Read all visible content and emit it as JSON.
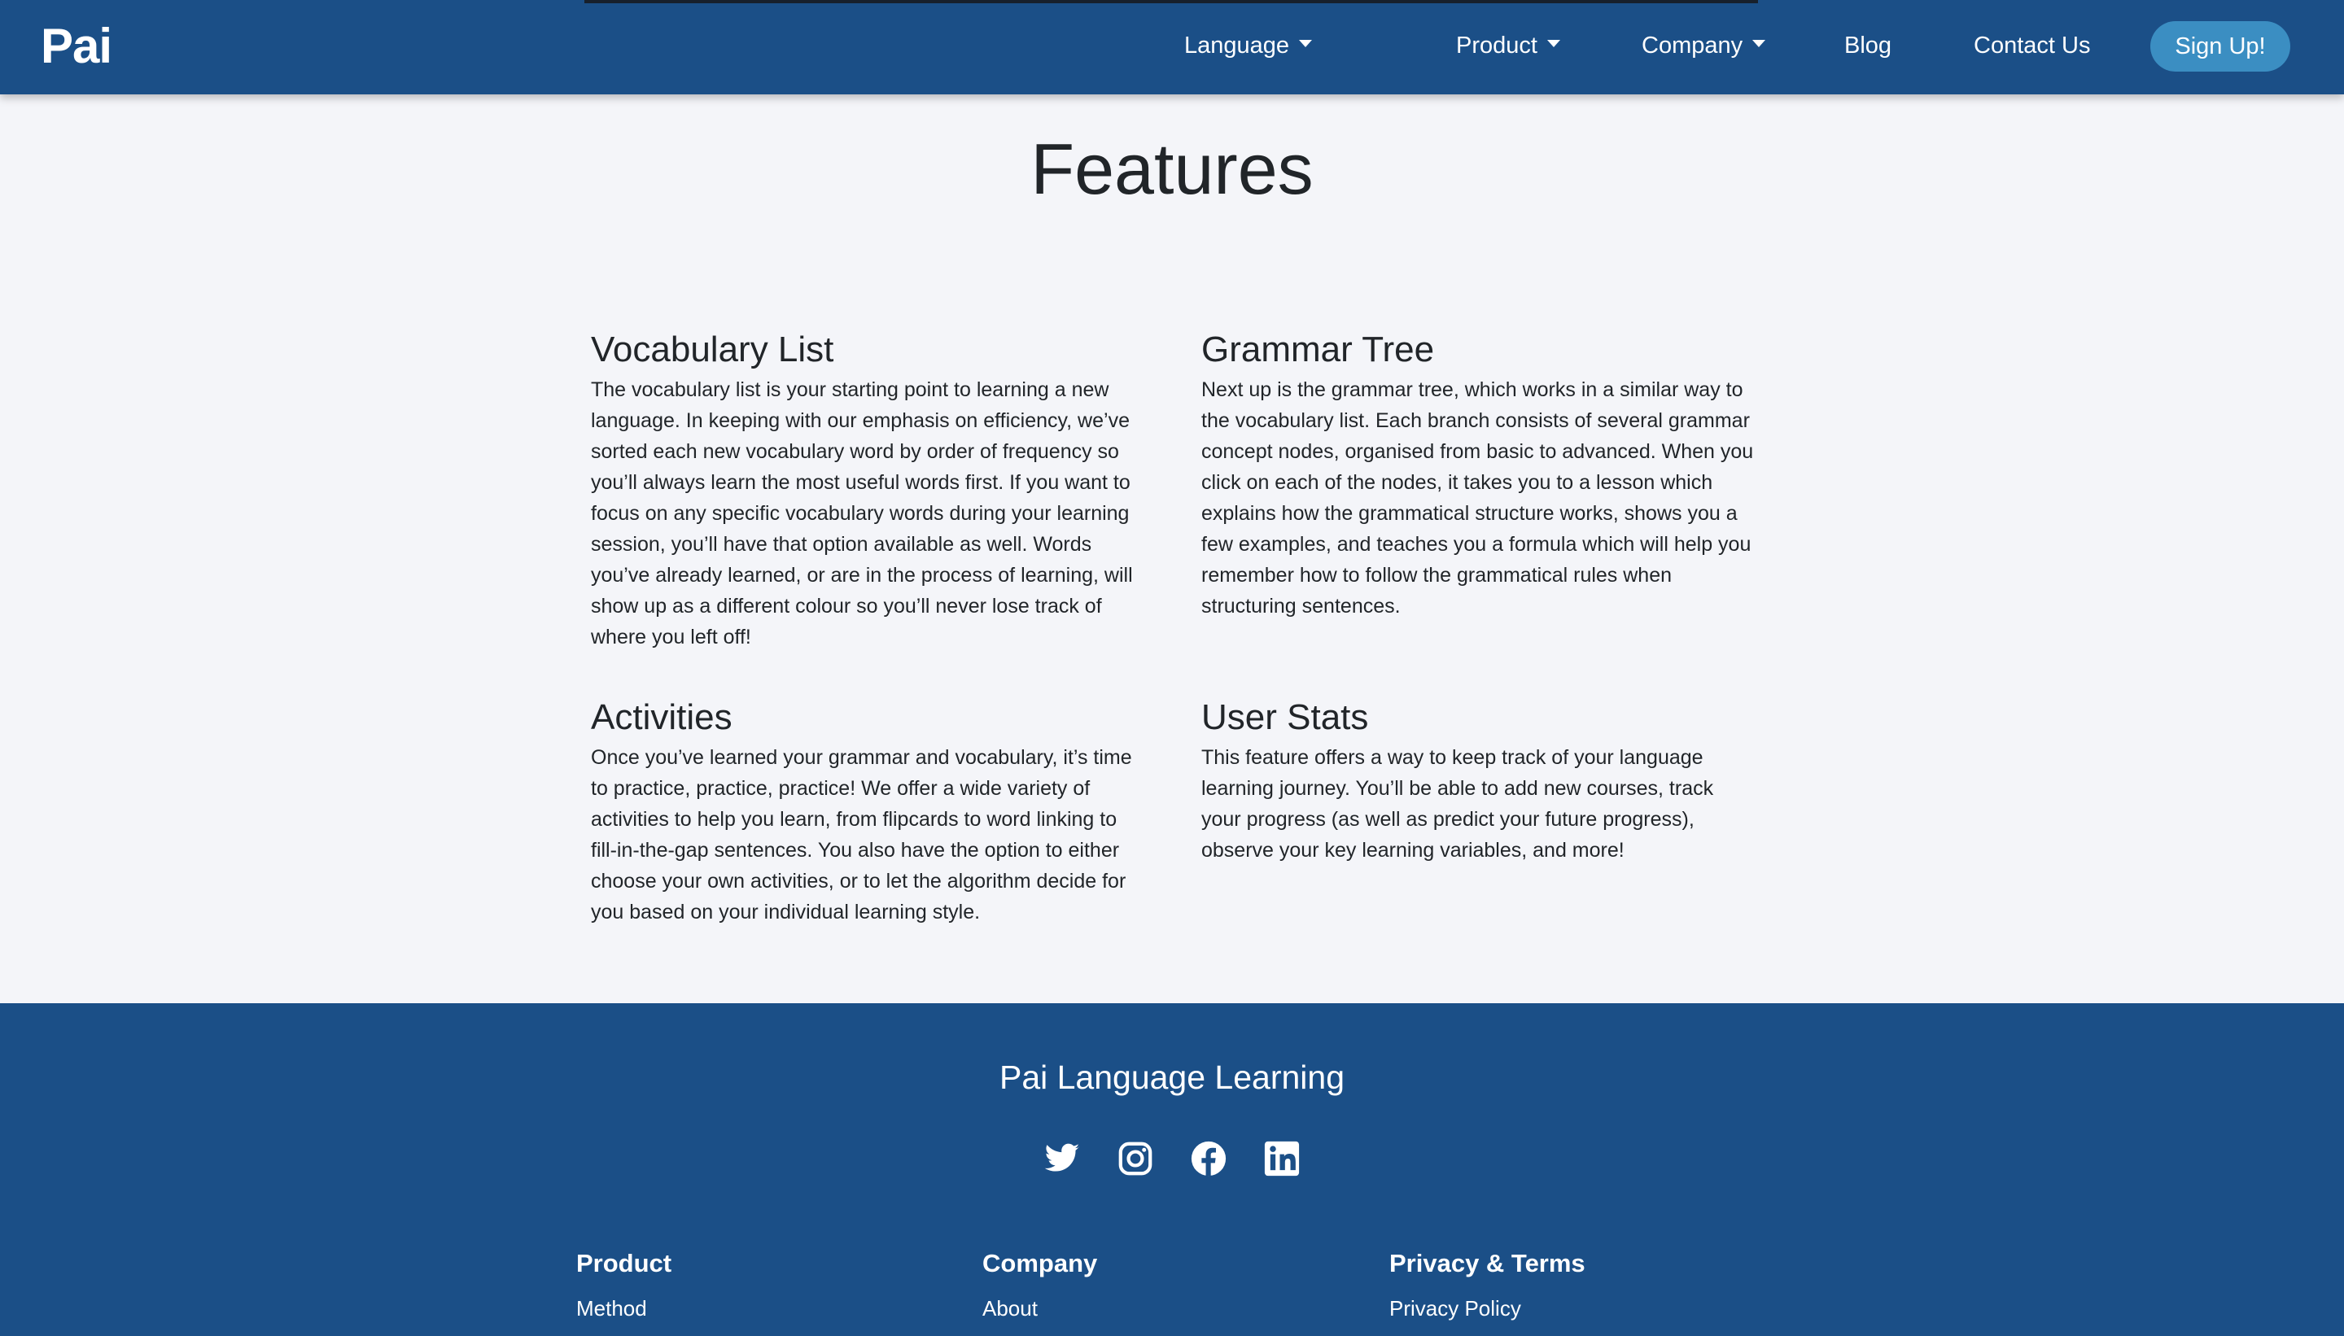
{
  "nav": {
    "logo": "Pai",
    "items": [
      {
        "label": "Language",
        "dropdown": true
      },
      {
        "label": "Product",
        "dropdown": true
      },
      {
        "label": "Company",
        "dropdown": true
      },
      {
        "label": "Blog",
        "dropdown": false
      },
      {
        "label": "Contact Us",
        "dropdown": false
      }
    ],
    "signup_label": "Sign Up!"
  },
  "main": {
    "title": "Features",
    "features": [
      {
        "title": "Vocabulary List",
        "body": "The vocabulary list is your starting point to learning a new language. In keeping with our emphasis on efficiency, we’ve sorted each new vocabulary word by order of frequency so you’ll always learn the most useful words first. If you want to focus on any specific vocabulary words during your learning session, you’ll have that option available as well. Words you’ve already learned, or are in the process of learning, will show up as a different colour so you’ll never lose track of where you left off!"
      },
      {
        "title": "Grammar Tree",
        "body": "Next up is the grammar tree, which works in a similar way to the vocabulary list. Each branch consists of several grammar concept nodes, organised from basic to advanced. When you click on each of the nodes, it takes you to a lesson which explains how the grammatical structure works, shows you a few examples, and teaches you a formula which will help you remember how to follow the grammatical rules when structuring sentences."
      },
      {
        "title": "Activities",
        "body": "Once you’ve learned your grammar and vocabulary, it’s time to practice, practice, practice! We offer a wide variety of activities to help you learn, from flipcards to word linking to fill-in-the-gap sentences. You also have the option to either choose your own activities, or to let the algorithm decide for you based on your individual learning style."
      },
      {
        "title": "User Stats",
        "body": "This feature offers a way to keep track of your language learning journey. You’ll be able to add new courses, track your progress (as well as predict your future progress), observe your key learning variables, and more!"
      }
    ]
  },
  "footer": {
    "brand": "Pai Language Learning",
    "social": [
      "twitter-icon",
      "instagram-icon",
      "facebook-icon",
      "linkedin-icon"
    ],
    "columns": [
      {
        "title": "Product",
        "links": [
          "Method"
        ]
      },
      {
        "title": "Company",
        "links": [
          "About"
        ]
      },
      {
        "title": "Privacy & Terms",
        "links": [
          "Privacy Policy"
        ]
      }
    ]
  },
  "colors": {
    "navbar": "#1b4f87",
    "accent_button": "#3b8ec2",
    "page_background": "#f4f5f9",
    "footer": "#1b4f87"
  }
}
